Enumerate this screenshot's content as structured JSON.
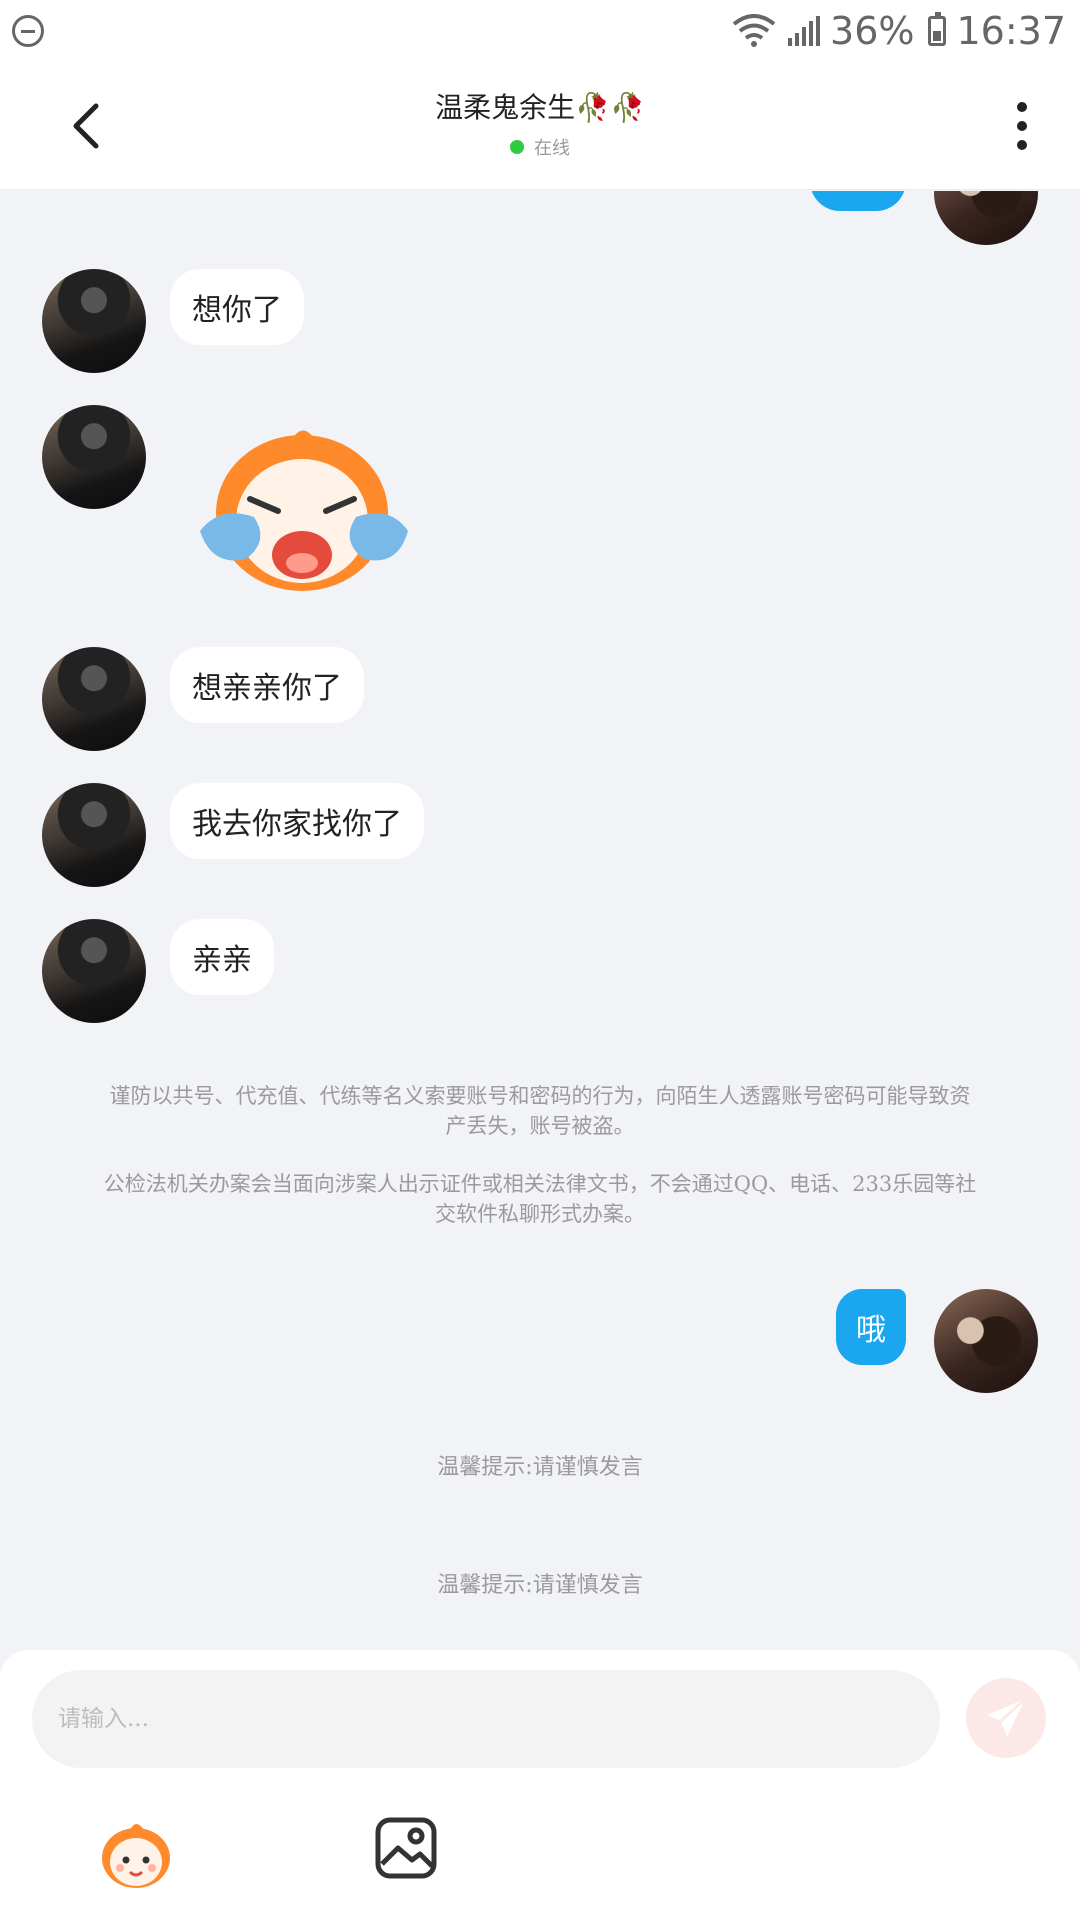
{
  "status_bar": {
    "signal": "36%",
    "time": "16:37",
    "icons": [
      "do-not-disturb-icon",
      "wifi-icon",
      "cell-signal-icon",
      "battery-icon"
    ]
  },
  "header": {
    "title": "温柔鬼余生🥀🥀",
    "status": "在线",
    "status_color": "#2ecc40"
  },
  "messages": {
    "m1": "想你了",
    "m3": "想亲亲你了",
    "m4": "我去你家找你了",
    "m5": "亲亲",
    "reply": "哦"
  },
  "notices": {
    "n1": "谨防以共号、代充值、代练等名义索要账号和密码的行为，向陌生人透露账号密码可能导致资产丢失，账号被盗。",
    "n2": "公检法机关办案会当面向涉案人出示证件或相关法律文书，不会通过QQ、电话、233乐园等社交软件私聊形式办案。"
  },
  "tips": {
    "t1": "温馨提示:请谨慎发言",
    "t2": "温馨提示:请谨慎发言"
  },
  "input": {
    "placeholder": "请输入...",
    "value": ""
  },
  "colors": {
    "accent": "#1aa7f0",
    "background": "#f2f3f7",
    "send_bg": "#fde8e8"
  }
}
